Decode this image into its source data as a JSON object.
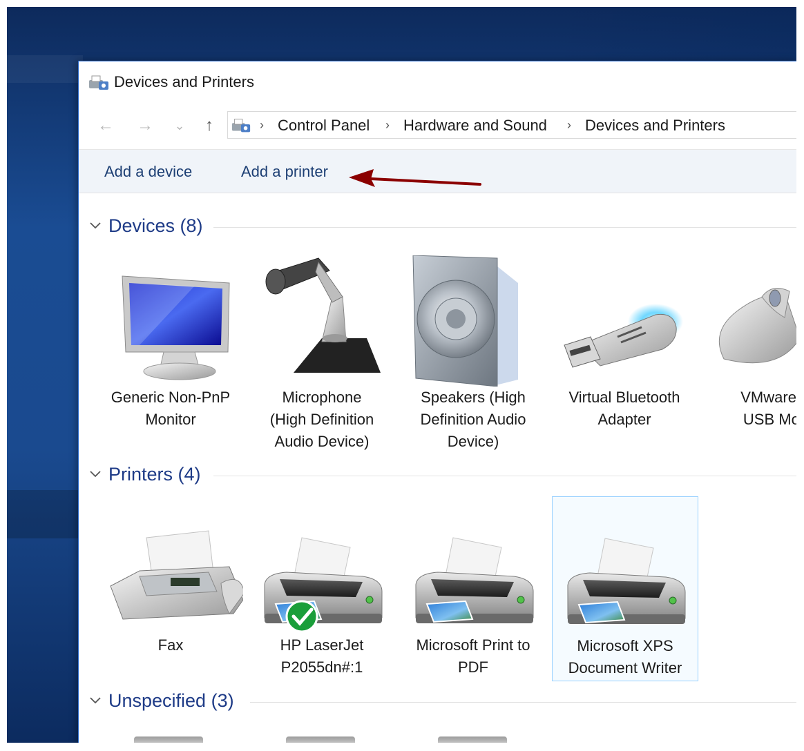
{
  "window": {
    "title": "Devices and Printers"
  },
  "nav": {
    "back": "←",
    "forward": "→",
    "recent": "⌄",
    "up": "↑",
    "breadcrumb": [
      "Control Panel",
      "Hardware and Sound",
      "Devices and Printers"
    ],
    "separator": "›"
  },
  "commands": {
    "add_device": "Add a device",
    "add_printer": "Add a printer"
  },
  "groups": {
    "devices": {
      "title": "Devices (8)",
      "items": [
        {
          "label": "Generic Non-PnP\nMonitor",
          "icon": "monitor-icon"
        },
        {
          "label": "Microphone\n(High Definition\nAudio Device)",
          "icon": "microphone-icon"
        },
        {
          "label": "Speakers (High\nDefinition Audio\nDevice)",
          "icon": "speaker-icon"
        },
        {
          "label": "Virtual Bluetooth\nAdapter",
          "icon": "usb-bluetooth-icon"
        },
        {
          "label": "VMware V\nUSB Mou",
          "icon": "mouse-icon"
        }
      ]
    },
    "printers": {
      "title": "Printers (4)",
      "items": [
        {
          "label": "Fax",
          "icon": "fax-icon"
        },
        {
          "label": "HP LaserJet\nP2055dn#:1",
          "icon": "printer-icon",
          "default": true
        },
        {
          "label": "Microsoft Print to\nPDF",
          "icon": "printer-icon"
        },
        {
          "label": "Microsoft XPS\nDocument Writer",
          "icon": "printer-icon",
          "selected": true
        }
      ]
    },
    "unspecified": {
      "title": "Unspecified (3)"
    }
  },
  "colors": {
    "accent": "#1e3b87",
    "link": "#1d3f74",
    "annotation_arrow": "#8b0000",
    "check": "#1a9e3a"
  }
}
